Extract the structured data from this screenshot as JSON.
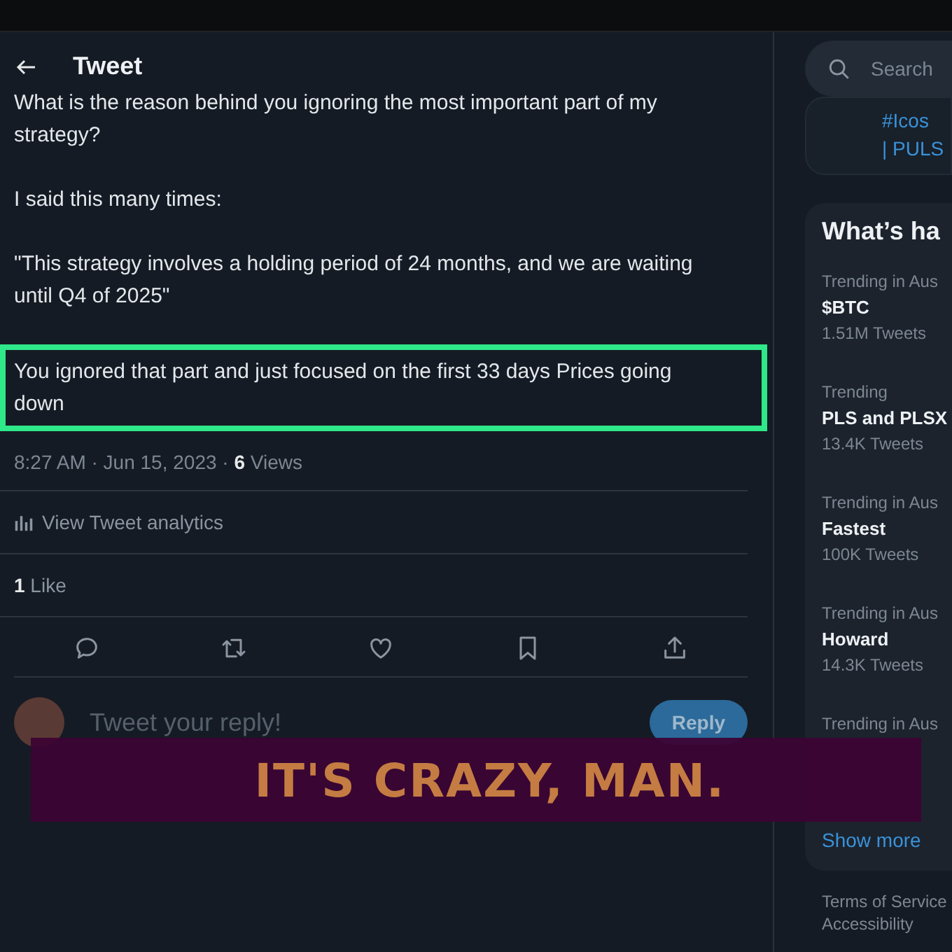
{
  "header": {
    "title": "Tweet"
  },
  "tweet": {
    "paragraphs": [
      {
        "text": "What is the reason behind you ignoring the most important part of my strategy?",
        "highlighted": false
      },
      {
        "text": "I said this many times:",
        "highlighted": false
      },
      {
        "text": "\"This strategy involves a holding period of 24 months, and we are waiting until Q4 of 2025\"",
        "highlighted": false
      },
      {
        "text": "You ignored that part and just focused on the first 33 days Prices going down",
        "highlighted": true
      }
    ],
    "timestamp": "8:27 AM · Jun 15, 2023 · ",
    "views_count": "6",
    "views_label": " Views",
    "analytics": "View Tweet analytics",
    "likes_count": "1",
    "likes_label": " Like",
    "actions": [
      {
        "kind": "reply"
      },
      {
        "kind": "retweet"
      },
      {
        "kind": "like"
      },
      {
        "kind": "bookmark"
      },
      {
        "kind": "share"
      }
    ]
  },
  "reply": {
    "placeholder": "Tweet your reply!",
    "button": "Reply"
  },
  "sidebar": {
    "search": {
      "placeholder": "Search"
    },
    "promo": [
      "#Icos",
      "| PULS"
    ],
    "trends_title": "What’s ha",
    "trends": [
      {
        "context": "Trending in Aus",
        "topic": "$BTC",
        "count": "1.51M Tweets"
      },
      {
        "context": "Trending",
        "topic": "PLS and PLSX",
        "count": "13.4K Tweets"
      },
      {
        "context": "Trending in Aus",
        "topic": "Fastest",
        "count": "100K Tweets"
      },
      {
        "context": "Trending in Aus",
        "topic": "Howard",
        "count": "14.3K Tweets"
      },
      {
        "context": "Trending in Aus"
      }
    ],
    "show_more": "Show more",
    "footer": [
      "Terms of Service",
      "Accessibility"
    ]
  },
  "caption": "IT'S CRAZY, MAN."
}
